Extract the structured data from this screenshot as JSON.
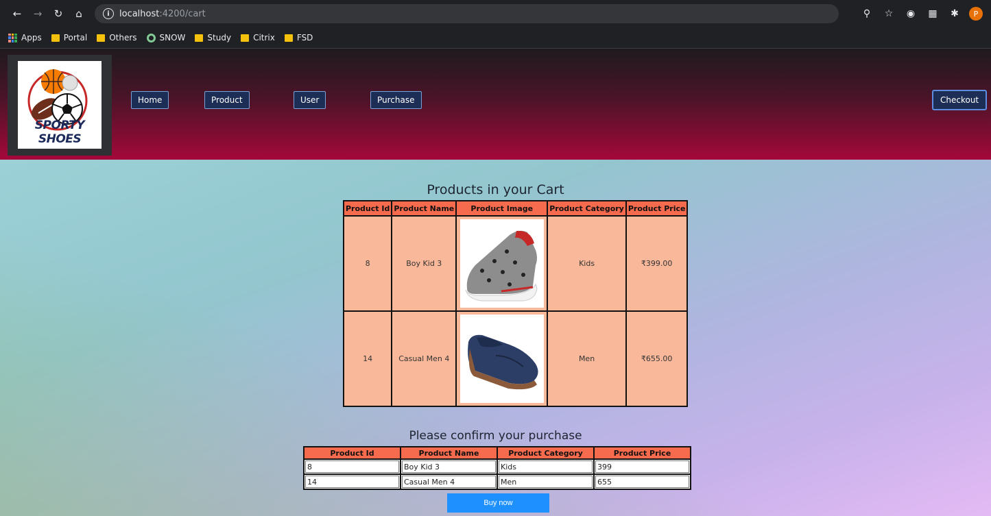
{
  "browser": {
    "url_host": "localhost",
    "url_path": ":4200/cart",
    "profile_initial": "P",
    "bookmarks": [
      "Apps",
      "Portal",
      "Others",
      "SNOW",
      "Study",
      "Citrix",
      "FSD"
    ]
  },
  "header": {
    "logo_text": "SPORTY SHOES",
    "nav": [
      "Home",
      "Product",
      "User",
      "Purchase"
    ],
    "checkout_label": "Checkout"
  },
  "cart": {
    "title": "Products in your Cart",
    "columns": [
      "Product Id",
      "Product Name",
      "Product Image",
      "Product Category",
      "Product Price"
    ],
    "rows": [
      {
        "id": "8",
        "name": "Boy Kid 3",
        "image": "grey-slip-on-shoe",
        "category": "Kids",
        "price": "₹399.00"
      },
      {
        "id": "14",
        "name": "Casual Men 4",
        "image": "navy-loafer-shoe",
        "category": "Men",
        "price": "₹655.00"
      }
    ]
  },
  "confirm": {
    "title": "Please confirm your purchase",
    "columns": [
      "Product Id",
      "Product Name",
      "Product Category",
      "Product Price"
    ],
    "rows": [
      {
        "id": "8",
        "name": "Boy Kid 3",
        "category": "Kids",
        "price": "399"
      },
      {
        "id": "14",
        "name": "Casual Men 4",
        "category": "Men",
        "price": "655"
      }
    ],
    "buy_label": "Buy now"
  },
  "colors": {
    "header_top": "#1e1a1e",
    "header_bottom": "#a5083a",
    "table_header": "#f66a4d",
    "table_cell": "#f9b89a",
    "buy_button": "#1e90ff"
  }
}
